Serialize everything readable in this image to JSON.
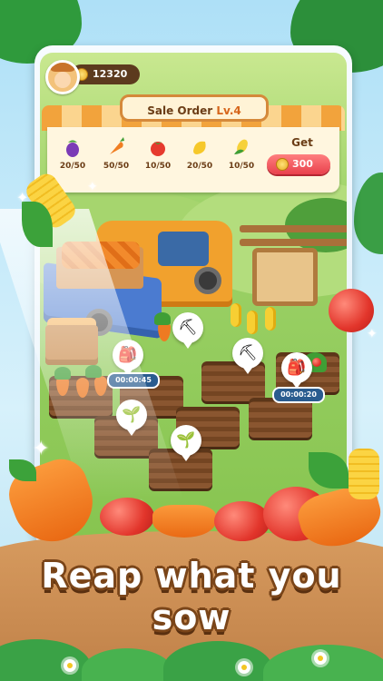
{
  "hud": {
    "coins": "12320"
  },
  "sale_order": {
    "title": "Sale Order",
    "level": "Lv.4",
    "items": [
      {
        "icon": "eggplant-icon",
        "count": "20/50"
      },
      {
        "icon": "carrot-icon",
        "count": "50/50"
      },
      {
        "icon": "tomato-icon",
        "count": "10/50"
      },
      {
        "icon": "mango-icon",
        "count": "20/50"
      },
      {
        "icon": "corn-icon",
        "count": "10/50"
      }
    ],
    "get_label": "Get",
    "reward": "300"
  },
  "timers": [
    "00:00:45",
    "00:00:20"
  ],
  "caption": {
    "line1": "Reap what you",
    "line2": "sow"
  },
  "colors": {
    "coin_pill": "#5c3a1e",
    "get_button": "#e9404c",
    "timer": "#2a5c8f",
    "caption_outline": "#7a4519"
  }
}
